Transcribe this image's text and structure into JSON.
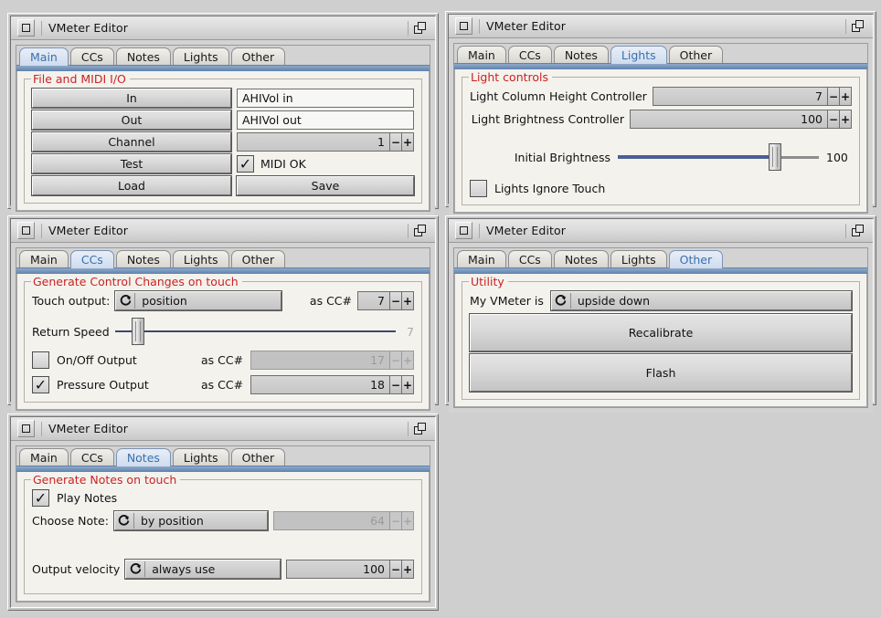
{
  "app": {
    "title": "VMeter Editor"
  },
  "icons": {
    "window_menu": "window-square-icon",
    "restore": "restore-windows-icon",
    "combo": "cycle-arrow-icon",
    "check": "✓",
    "minus": "−",
    "plus": "+"
  },
  "tabs": [
    "Main",
    "CCs",
    "Notes",
    "Lights",
    "Other"
  ],
  "windows": [
    {
      "id": "main",
      "title": "VMeter Editor",
      "selected_tab": "Main",
      "group_title": "File and MIDI I/O",
      "rows": [
        {
          "button": "In",
          "value": "AHIVol in"
        },
        {
          "button": "Out",
          "value": "AHIVol out"
        },
        {
          "button": "Channel",
          "spin_value": "1"
        },
        {
          "button": "Test",
          "checkbox_label": "MIDI OK",
          "checked": true
        },
        {
          "button": "Load",
          "button2": "Save"
        }
      ]
    },
    {
      "id": "lights",
      "title": "VMeter Editor",
      "selected_tab": "Lights",
      "group_title": "Light controls",
      "column_height_label": "Light Column Height Controller",
      "column_height_value": "7",
      "brightness_label": "Light Brightness Controller",
      "brightness_value": "100",
      "initial_brightness_label": "Initial Brightness",
      "initial_brightness_value": "100",
      "initial_brightness_pct": 78,
      "ignore_touch_label": "Lights Ignore Touch",
      "ignore_touch_checked": false
    },
    {
      "id": "ccs",
      "title": "VMeter Editor",
      "selected_tab": "CCs",
      "group_title": "Generate Control Changes on touch",
      "touch_output_label": "Touch output:",
      "touch_output_value": "position",
      "touch_cc_label": "as CC#",
      "touch_cc_value": "7",
      "return_speed_label": "Return Speed",
      "return_speed_value": "7",
      "return_speed_pct": 7,
      "onoff_label": "On/Off Output",
      "onoff_checked": false,
      "onoff_cc_label": "as CC#",
      "onoff_cc_value": "17",
      "onoff_cc_disabled": true,
      "pressure_label": "Pressure Output",
      "pressure_checked": true,
      "pressure_cc_label": "as CC#",
      "pressure_cc_value": "18"
    },
    {
      "id": "other",
      "title": "VMeter Editor",
      "selected_tab": "Other",
      "group_title": "Utility",
      "orientation_label": "My VMeter is",
      "orientation_value": "upside down",
      "recalibrate_label": "Recalibrate",
      "flash_label": "Flash"
    },
    {
      "id": "notes",
      "title": "VMeter Editor",
      "selected_tab": "Notes",
      "group_title": "Generate Notes on touch",
      "play_notes_label": "Play Notes",
      "play_notes_checked": true,
      "choose_note_label": "Choose Note:",
      "choose_note_value": "by position",
      "note_number_value": "64",
      "note_number_disabled": true,
      "velocity_label": "Output velocity",
      "velocity_mode": "always use",
      "velocity_value": "100"
    }
  ],
  "colors": {
    "desktop": "#cfcfcf",
    "group_title": "#cc2222",
    "tab_selected_text": "#3b6fb0",
    "tab_bar_blue": "#5f82ad",
    "slider_fill": "#4a5f94"
  }
}
